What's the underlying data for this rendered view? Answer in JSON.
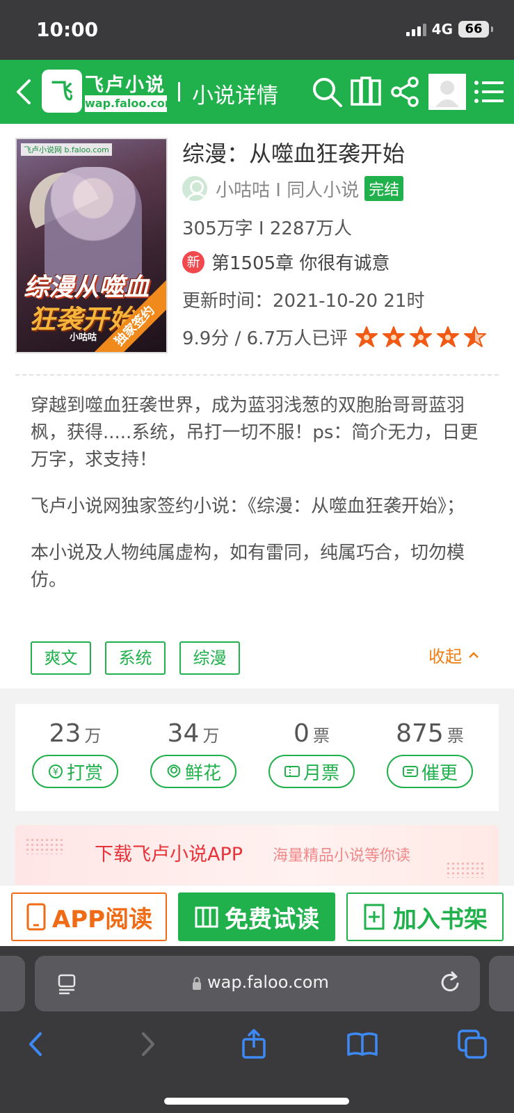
{
  "status_bar": {
    "time": "10:00",
    "network": "4G",
    "battery": "66"
  },
  "header": {
    "logo_badge": "飞",
    "logo_brand": "飞卢小说",
    "logo_domain": "wap.faloo.com",
    "separator": "I",
    "title": "小说详情",
    "icons": [
      "back-arrow-icon",
      "search-icon",
      "bookshelf-icon",
      "share-icon",
      "user-avatar-icon",
      "menu-icon"
    ]
  },
  "book": {
    "cover": {
      "site_tag": "飞卢小说网 b.faloo.com",
      "line1": "综漫",
      "line2": "从噬血",
      "line3": "狂袭开始",
      "author": "小咕咕",
      "ribbon": "独家签约"
    },
    "title": "综漫：从噬血狂袭开始",
    "author_line": "小咕咕 I 同人小说",
    "status_badge": "完结",
    "stats_line": "305万字 I 2287万人",
    "new_badge": "新",
    "latest_chapter": "第1505章 你很有诚意",
    "update_time": "更新时间：2021-10-20 21时",
    "rating_text": "9.9分 / 6.7万人已评",
    "rating_stars": 4.5,
    "star_color": "#f05a14"
  },
  "description": {
    "p1": "穿越到噬血狂袭世界，成为蓝羽浅葱的双胞胎哥哥蓝羽枫，获得.....系统，吊打一切不服！ps：简介无力，日更万字，求支持！",
    "p2": "飞卢小说网独家签约小说：《综漫：从噬血狂袭开始》；",
    "p3": "本小说及人物纯属虚构，如有雷同，纯属巧合，切勿模仿。"
  },
  "tags": [
    "爽文",
    "系统",
    "综漫"
  ],
  "collapse_label": "收起",
  "support": [
    {
      "value": "23",
      "unit": "万",
      "label": "打赏",
      "icon": "coin-icon"
    },
    {
      "value": "34",
      "unit": "万",
      "label": "鲜花",
      "icon": "flower-icon"
    },
    {
      "value": "0",
      "unit": "票",
      "label": "月票",
      "icon": "ticket-icon"
    },
    {
      "value": "875",
      "unit": "票",
      "label": "催更",
      "icon": "urge-icon"
    }
  ],
  "banner": {
    "main": "下载飞卢小说APP",
    "sub": "海量精品小说等你读"
  },
  "actions": {
    "app_read": "APP阅读",
    "free_read": "免费试读",
    "add_shelf": "加入书架"
  },
  "browser": {
    "url": "wap.faloo.com"
  },
  "colors": {
    "brand_green": "#20b04c",
    "accent_orange": "#f06b16",
    "badge_red": "#f0484c"
  }
}
